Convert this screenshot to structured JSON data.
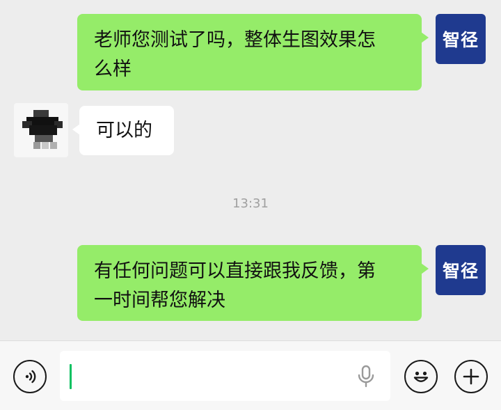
{
  "messages": [
    {
      "side": "out",
      "text_lines": [
        "老师您测试了吗，整体生图效果怎",
        "么样"
      ],
      "avatar_label": "智径"
    },
    {
      "side": "in",
      "text": "可以的"
    },
    {
      "side": "out",
      "text_lines": [
        "有任何问题可以直接跟我反馈，第",
        "一时间帮您解决"
      ],
      "avatar_label": "智径"
    }
  ],
  "timestamp": "13:31",
  "input": {
    "value": ""
  },
  "icons": [
    "voice-icon",
    "microphone-icon",
    "emoji-icon",
    "plus-icon"
  ],
  "colors": {
    "background": "#ededed",
    "outgoing_bubble": "#95ec69",
    "incoming_bubble": "#ffffff",
    "avatar_brand": "#1f3a8f",
    "caret": "#07c160"
  }
}
